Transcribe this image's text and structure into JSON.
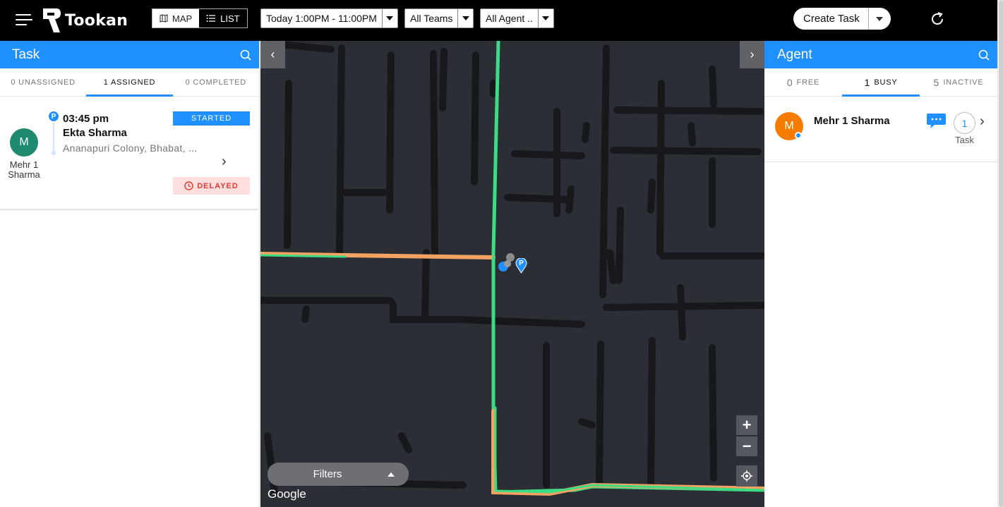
{
  "topbar": {
    "brand": "Tookan",
    "view_map": "MAP",
    "view_list": "LIST",
    "date_filter": "Today 1:00PM - 11:00PM",
    "team_filter": "All Teams",
    "agent_filter": "All Agent ..",
    "create_task": "Create Task"
  },
  "task_panel": {
    "title": "Task",
    "tabs": [
      {
        "label": "0 Unassigned"
      },
      {
        "label": "1 Assigned",
        "active": true
      },
      {
        "label": "0 Completed"
      }
    ],
    "tasks": [
      {
        "agent_initial": "M",
        "agent_name": "Mehr 1 Sharma",
        "pickup_badge": "P",
        "time": "03:45 pm",
        "customer": "Ekta Sharma",
        "address": "Ananapuri Colony, Bhabat, ...",
        "status": "STARTED",
        "delay": "DELAYED"
      }
    ]
  },
  "map": {
    "filters_label": "Filters",
    "attribution": "Google",
    "marker_label": "P",
    "zoom_in": "+",
    "zoom_out": "−",
    "prev": "‹",
    "next": "›"
  },
  "agent_panel": {
    "title": "Agent",
    "tabs": [
      {
        "count": "0",
        "label": "Free"
      },
      {
        "count": "1",
        "label": "Busy",
        "active": true
      },
      {
        "count": "5",
        "label": "Inactive"
      }
    ],
    "agents": [
      {
        "initial": "M",
        "name": "Mehr 1 Sharma",
        "task_count": "1",
        "task_label": "Task"
      }
    ]
  },
  "colors": {
    "primary": "#1e90ff",
    "map_bg": "#2b2e35",
    "road": "#16181c",
    "route_green": "#3ddc84",
    "route_orange": "#f4a261",
    "agent_avatar_task": "#1e8a6e",
    "agent_avatar_list": "#f57c00",
    "delay_red": "#e53935"
  },
  "icons": [
    "menu-icon",
    "map-icon",
    "list-icon",
    "refresh-icon",
    "search-icon",
    "chat-icon",
    "clock-icon",
    "locate-icon",
    "chevron-right-icon"
  ]
}
